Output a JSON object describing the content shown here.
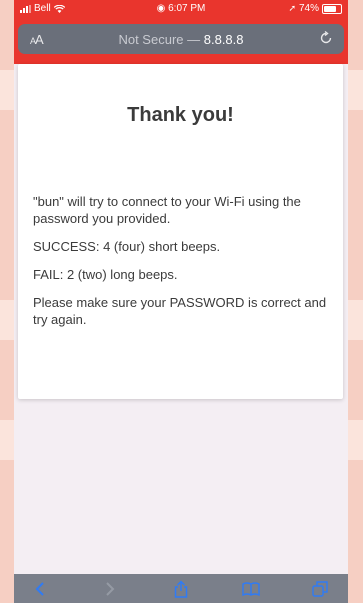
{
  "status_bar": {
    "carrier": "Bell",
    "time": "6:07 PM",
    "battery": "74%",
    "battery_level": 0.74
  },
  "url_bar": {
    "text_size_button": "AA",
    "security_label": "Not Secure —",
    "domain": "8.8.8.8"
  },
  "content": {
    "title": "Thank you!",
    "paragraphs": [
      "\"bun\" will try to connect to your Wi-Fi using the password you provided.",
      "SUCCESS: 4 (four) short beeps.",
      "FAIL: 2 (two) long beeps.",
      "Please make sure your PASSWORD is correct and try again."
    ]
  },
  "toolbar": {
    "items": [
      "back-icon",
      "forward-icon",
      "share-icon",
      "bookmarks-icon",
      "tabs-icon"
    ]
  },
  "colors": {
    "accent": "#e9352d",
    "toolbar": "#7a7f8a",
    "page_bg": "#f4eef3"
  }
}
